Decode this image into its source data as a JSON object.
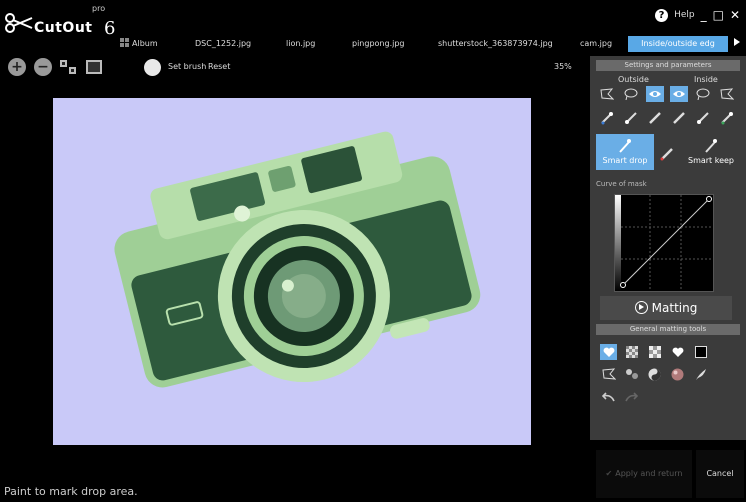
{
  "app": {
    "logo_pro": "pro",
    "logo_name": "CutOut",
    "logo_version": "6",
    "help_label": "Help"
  },
  "tabs": [
    {
      "label": "Album"
    },
    {
      "label": "DSC_1252.jpg"
    },
    {
      "label": "lion.jpg"
    },
    {
      "label": "pingpong.jpg"
    },
    {
      "label": "shutterstock_363873974.jpg"
    },
    {
      "label": "cam.jpg"
    },
    {
      "label": "Inside/outside edg"
    }
  ],
  "toolbar": {
    "set_brush": "Set brush",
    "reset": "Reset",
    "zoom_level": "35%"
  },
  "status": "Paint to mark drop area.",
  "panel": {
    "settings_title": "Settings and parameters",
    "outside_label": "Outside",
    "inside_label": "Inside",
    "smart_drop": "Smart drop",
    "smart_keep": "Smart keep",
    "curve_label": "Curve of mask",
    "matting_label": "Matting",
    "general_tools_title": "General matting tools"
  },
  "buttons": {
    "apply": "Apply and return",
    "cancel": "Cancel"
  },
  "colors": {
    "accent": "#6aaee6",
    "photo_background": "#c9c9f8",
    "camera_tint": "#2d5a3e"
  }
}
